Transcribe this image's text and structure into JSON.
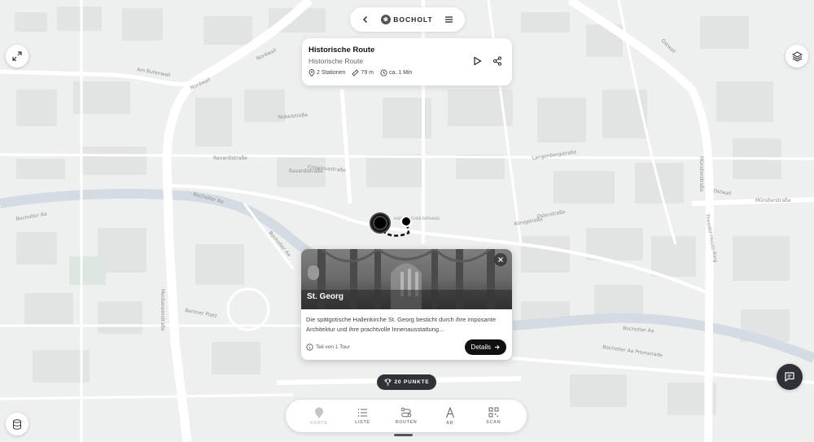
{
  "header": {
    "brand": "BOCHOLT"
  },
  "route": {
    "title": "Historische Route",
    "subtitle": "Historische Route",
    "stations": "2 Stationen",
    "distance": "79 m",
    "duration": "ca. 1 Min"
  },
  "poi": {
    "title": "St. Georg",
    "description": "Die spätgotische Hallenkirche St. Georg besticht durch ihre imposante Architektur und ihre prachtvolle Innenausstattung...",
    "tour_info": "Teil von 1 Tour",
    "details_label": "Details"
  },
  "points_badge": "20 PUNKTE",
  "nav": {
    "items": [
      {
        "label": "KARTE",
        "icon": "map-pin-icon",
        "active": true
      },
      {
        "label": "LISTE",
        "icon": "list-icon",
        "active": false
      },
      {
        "label": "ROUTEN",
        "icon": "route-icon",
        "active": false
      },
      {
        "label": "AR",
        "icon": "ar-icon",
        "active": false
      },
      {
        "label": "SCAN",
        "icon": "qr-scan-icon",
        "active": false
      }
    ]
  },
  "map_labels": {
    "nordwall": "Nordwall",
    "nordwall2": "Nordwall",
    "am_butenwall": "Am Butenwall",
    "ostwall": "Ostwall",
    "ostwall2": "Ostwall",
    "muensterstrasse": "Münsterstraße",
    "muensterstrasse2": "Münsterstraße",
    "bocholter_aa_w": "Bocholter Aa",
    "bocholter_aa_c": "Bocholter Aa",
    "bocholter_aa_e": "Bocholter Aa",
    "bocholter_aa_sw": "Bocholter Aa",
    "meckenemstrasse": "Meckenemstraße",
    "berliner_platz": "Berliner Platz",
    "ravardistrasse_w": "Ravardistraße",
    "ravardistrasse_e": "Ravardistraße",
    "nobelstrasse": "Nobelstraße",
    "crispinusstrasse": "Crispinusstraße",
    "langenbergstrasse": "Langenbergstraße",
    "koenigstrasse": "Königstraße",
    "osterstrasse": "Osterstraße",
    "theodor_heuss_ring": "Theodor-Heuss-Ring",
    "bocholter_aa_promenade": "Bocholter Aa Promenade",
    "historisches_rathaus": "HISTORISCHES RATHAUS"
  },
  "colors": {
    "map_bg": "#eef0ef",
    "road": "#ffffff",
    "river": "#d4dbe2",
    "block": "#e2e4e3",
    "dark": "#2f3236"
  }
}
